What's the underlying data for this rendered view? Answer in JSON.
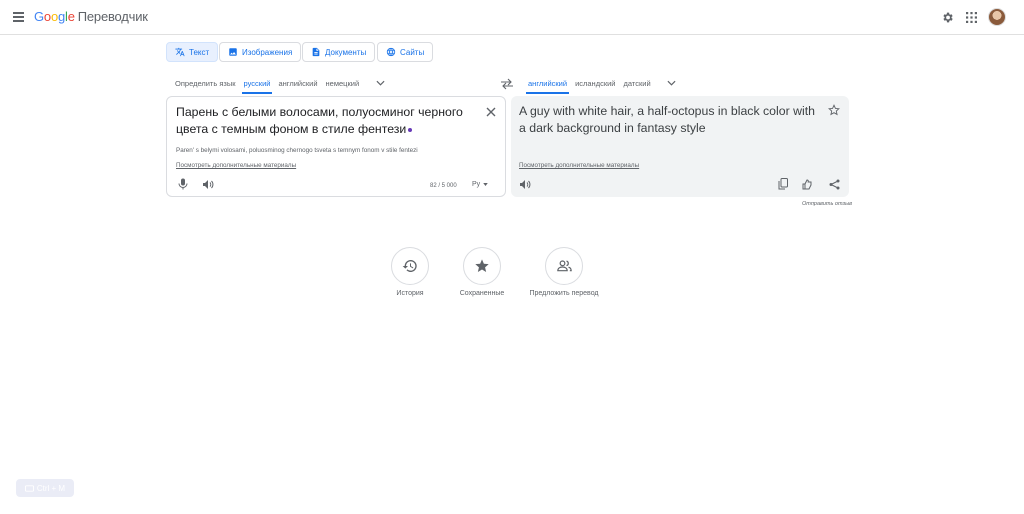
{
  "header": {
    "logo": {
      "g": "G",
      "o1": "o",
      "o2": "o",
      "g2": "g",
      "l": "l",
      "e": "e",
      "product": "Переводчик"
    },
    "icons": [
      "menu-icon",
      "gear-icon",
      "apps-icon",
      "avatar"
    ]
  },
  "modes": [
    {
      "label": "Текст",
      "icon": "translate-icon",
      "active": true
    },
    {
      "label": "Изображения",
      "icon": "image-icon",
      "active": false
    },
    {
      "label": "Документы",
      "icon": "document-icon",
      "active": false
    },
    {
      "label": "Сайты",
      "icon": "globe-icon",
      "active": false
    }
  ],
  "source_langs": [
    "Определить язык",
    "русский",
    "английский",
    "немецкий"
  ],
  "target_langs": [
    "английский",
    "исландский",
    "датский"
  ],
  "source": {
    "text": "Парень с белыми волосами, полуосминог черного цвета с темным фоном в стиле фентези",
    "transliteration": "Paren' s belymi volosami, poluosminog chernogo tsveta s temnym fonom v stile fentezi",
    "more_link": "Посмотреть дополнительные материалы",
    "char_count": "82 / 5 000",
    "keyboard": "Ру"
  },
  "target": {
    "text": "A guy with white hair, a half-octopus in black color with a dark background in fantasy style",
    "more_link": "Посмотреть дополнительные материалы",
    "feedback": "Отправить отзыв"
  },
  "shortcuts": [
    {
      "label": "История",
      "icon": "history-icon"
    },
    {
      "label": "Сохраненные",
      "icon": "star-icon"
    },
    {
      "label": "Предложить перевод",
      "icon": "people-icon"
    }
  ],
  "ctrl_m": "Ctrl + M",
  "colors": {
    "accent": "#1a73e8",
    "panel_bg": "#f1f3f4",
    "cursor": "#673ab7"
  }
}
